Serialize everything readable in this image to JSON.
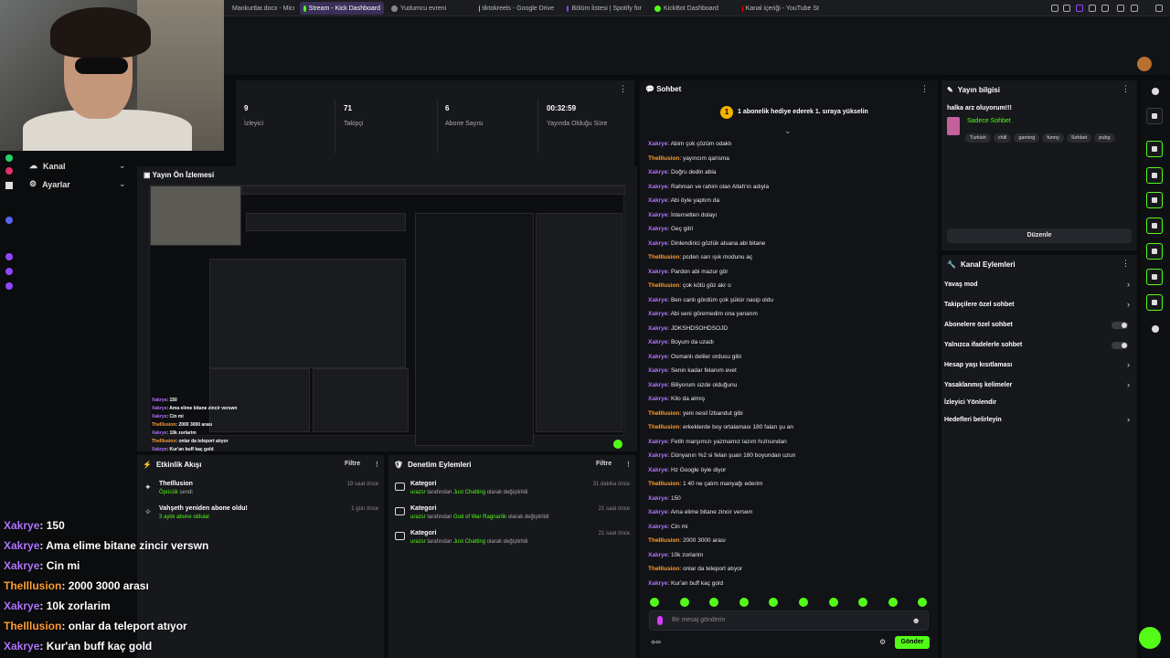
{
  "browser": {
    "tabs": [
      {
        "label": "Mankurtlar.docx - Microso",
        "color": "#2b579a"
      },
      {
        "label": "Stream - Kick Dashboard",
        "color": "#53fc18",
        "active": true
      },
      {
        "label": "Yudumcu evreni",
        "color": "#888888"
      },
      {
        "label": "tiktokreels - Google Drive",
        "color": "#f4b400"
      },
      {
        "label": "Bölüm listesi | Spotify for",
        "color": "#9146ff"
      },
      {
        "label": "KickBot Dashboard",
        "color": "#53fc18"
      },
      {
        "label": "Kanal içeriği - YouTube St",
        "color": "#ff0000"
      }
    ]
  },
  "sidebar": {
    "items": [
      {
        "label": "Kanal",
        "icon": "cloud-icon"
      },
      {
        "label": "Ayarlar",
        "icon": "gear-icon"
      }
    ]
  },
  "stats": [
    {
      "value": "9",
      "label": "İzleyici"
    },
    {
      "value": "71",
      "label": "Takipçi"
    },
    {
      "value": "6",
      "label": "Abone Sayısı"
    },
    {
      "value": "00:32:59",
      "label": "Yayında Olduğu Süre"
    }
  ],
  "preview": {
    "title": "Yayın Ön İzlemesi"
  },
  "activity": {
    "title": "Etkinlik Akışı",
    "filter": "Filtre",
    "events": [
      {
        "title": "TheIllusion",
        "sub": "Öpücük",
        "sub2": "sendi",
        "time": "19 saat önce"
      },
      {
        "title": "Vahşeth yeniden abone oldu!",
        "sub": "3 aylık abone oldular",
        "sub2": "",
        "time": "1 gün önce"
      }
    ]
  },
  "moderation": {
    "title": "Denetim Eylemleri",
    "filter": "Filtre",
    "events": [
      {
        "title": "Kategori",
        "user": "urazsr",
        "mid": "tarafından",
        "cat": "Just Chatting",
        "tail": "olarak değiştirildi",
        "time": "31 dakika önce"
      },
      {
        "title": "Kategori",
        "user": "urazsr",
        "mid": "tarafından",
        "cat": "God of War Ragnarök",
        "tail": "olarak değiştirildi",
        "time": "21 saat önce"
      },
      {
        "title": "Kategori",
        "user": "urazsr",
        "mid": "tarafından",
        "cat": "Just Chatting",
        "tail": "olarak değiştirildi",
        "time": "21 saat önce"
      }
    ]
  },
  "chat": {
    "title": "Sohbet",
    "banner": "1 abonelik hediye ederek 1. sıraya yükselin",
    "messages": [
      {
        "user": "Xakrye",
        "text": "Abim çok çözüm odaklı"
      },
      {
        "user": "TheIllusion",
        "text": "yayıncım qarisma"
      },
      {
        "user": "Xakrye",
        "text": "Doğru dedin abla"
      },
      {
        "user": "Xakrye",
        "text": "Rahman ve rahim olan Allah'ın adıyla"
      },
      {
        "user": "Xakrye",
        "text": "Abi öyle yaptım da"
      },
      {
        "user": "Xakrye",
        "text": "İnternetten dolayı"
      },
      {
        "user": "Xakrye",
        "text": "Geç gitri"
      },
      {
        "user": "Xakrye",
        "text": "Dinlendirici gözlük alsana abi bitane"
      },
      {
        "user": "TheIllusion",
        "text": "pcden sarı ışık modunu aç"
      },
      {
        "user": "Xakrye",
        "text": "Pardon abi mazur gör"
      },
      {
        "user": "TheIllusion",
        "text": "çok kötü göz akr o"
      },
      {
        "user": "Xakrye",
        "text": "Ben canlı gördüm çok şükür nasip oldu"
      },
      {
        "user": "Xakrye",
        "text": "Abi seni göremedim ona yanarım"
      },
      {
        "user": "Xakrye",
        "text": "JDKSHDSOHDSOJD"
      },
      {
        "user": "Xakrye",
        "text": "Boyum da uzadı"
      },
      {
        "user": "Xakrye",
        "text": "Osmanlı deliler ordusu gibi"
      },
      {
        "user": "Xakrye",
        "text": "Senin kadar felanım evet"
      },
      {
        "user": "Xakrye",
        "text": "Biliyorum sizde olduğunu"
      },
      {
        "user": "Xakrye",
        "text": "Kilo da almış"
      },
      {
        "user": "TheIllusion",
        "text": "yeni nesil İzbandut gibi"
      },
      {
        "user": "TheIllusion",
        "text": "erkeklerde boy ortalaması 180 falan şu an"
      },
      {
        "user": "Xakrye",
        "text": "Fetih marşımızı yazmamız lazım hızlısından"
      },
      {
        "user": "Xakrye",
        "text": "Dünyanın %2 si felan şuan 180 boyundan uzun"
      },
      {
        "user": "Xakrye",
        "text": "Hz Google öyle diyor"
      },
      {
        "user": "TheIllusion",
        "text": "1 40 ne çalım manyağı ederim"
      },
      {
        "user": "Xakrye",
        "text": "150"
      },
      {
        "user": "Xakrye",
        "text": "Ama elime bitane zincir verswn"
      },
      {
        "user": "Xakrye",
        "text": "Cin mi"
      },
      {
        "user": "TheIllusion",
        "text": "2000 3000 arası"
      },
      {
        "user": "Xakrye",
        "text": "10k zorlarim"
      },
      {
        "user": "TheIllusion",
        "text": "onlar da teleport atıyor"
      },
      {
        "user": "Xakrye",
        "text": "Kur'an buff kaç gold"
      }
    ],
    "input_placeholder": "Bir mesaj gönderin",
    "send_label": "Gönder"
  },
  "stream_info": {
    "title": "Yayın bilgisi",
    "stream_title": "halka arz oluyorum!!!",
    "category": "Sadece Sohbet",
    "tags": [
      "Turkish",
      "chill",
      "gaming",
      "funny",
      "Sohbet",
      "pubg"
    ],
    "edit_label": "Düzenle"
  },
  "channel_actions": {
    "title": "Kanal Eylemleri",
    "items": [
      {
        "label": "Yavaş mod",
        "control": "chevron"
      },
      {
        "label": "Takipçilere özel sohbet",
        "control": "chevron"
      },
      {
        "label": "Abonelere özel sohbet",
        "control": "toggle"
      },
      {
        "label": "Yalnızca ifadelerle sohbet",
        "control": "toggle"
      },
      {
        "label": "Hesap yaşı kısıtlaması",
        "control": "chevron"
      },
      {
        "label": "Yasaklanmış kelimeler",
        "control": "chevron"
      },
      {
        "label": "İzleyici Yönlendir",
        "control": "none"
      },
      {
        "label": "Hedefleri belirleyin",
        "control": "chevron"
      }
    ]
  },
  "overlay_chat": [
    {
      "user": "Xakrye",
      "text": "150"
    },
    {
      "user": "Xakrye",
      "text": "Ama elime bitane zincir verswn"
    },
    {
      "user": "Xakrye",
      "text": "Cin mi"
    },
    {
      "user": "TheIllusion",
      "text": "2000 3000 arası"
    },
    {
      "user": "Xakrye",
      "text": "10k zorlarim"
    },
    {
      "user": "TheIllusion",
      "text": "onlar da teleport atıyor"
    },
    {
      "user": "Xakrye",
      "text": "Kur'an buff kaç gold"
    }
  ],
  "preview_chat": [
    {
      "user": "Xakrye",
      "text": "150"
    },
    {
      "user": "Xakrye",
      "text": "Ama elime bitane zincir verswn"
    },
    {
      "user": "Xakrye",
      "text": "Cin mi"
    },
    {
      "user": "TheIllusion",
      "text": "2000 3000 arası"
    },
    {
      "user": "Xakrye",
      "text": "10k zorlarim"
    },
    {
      "user": "TheIllusion",
      "text": "onlar da teleport atıyor"
    },
    {
      "user": "Xakrye",
      "text": "Kur'an buff kaç gold"
    }
  ],
  "colors": {
    "accent": "#53fc18",
    "user_a": "#b174ff",
    "user_b": "#ff9c33"
  }
}
